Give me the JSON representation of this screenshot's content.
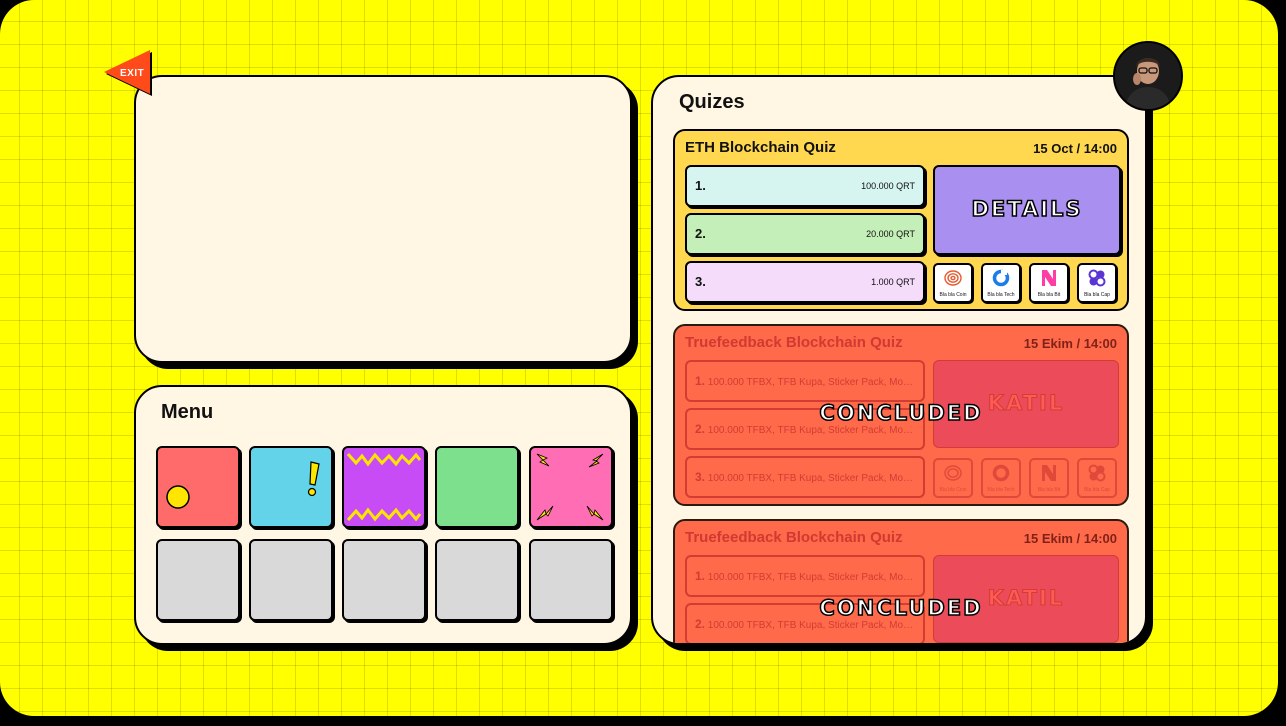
{
  "exit": {
    "label": "EXIT"
  },
  "menu": {
    "title": "Menu"
  },
  "quizzes": {
    "title": "Quizes",
    "items": [
      {
        "title": "ETH Blockchain Quiz",
        "date": "15 Oct / 14:00",
        "action": "DETAILS",
        "prizes": [
          {
            "rank": "1.",
            "amount": "100.000 QRT"
          },
          {
            "rank": "2.",
            "amount": "20.000 QRT"
          },
          {
            "rank": "3.",
            "amount": "1.000 QRT"
          }
        ],
        "sponsors": [
          "Bla bla Coin",
          "Bla bla Tech",
          "Bla bla Bit",
          "Bla bla Cap"
        ]
      },
      {
        "title": "Truefeedback Blockchain Quiz",
        "date": "15 Ekim / 14:00",
        "action": "KATIL",
        "status": "CONCLUDED",
        "prizes": [
          {
            "rank": "1.",
            "text": "100.000 TFBX, TFB Kupa, Sticker Pack, Mouse P..."
          },
          {
            "rank": "2.",
            "text": "100.000 TFBX, TFB Kupa, Sticker Pack, Mouse ..."
          },
          {
            "rank": "3.",
            "text": "100.000 TFBX, TFB Kupa, Sticker Pack, Mouse ..."
          }
        ],
        "sponsors": [
          "Bla bla Coin",
          "Bla bla Tech",
          "Bla bla Bit",
          "Bla bla Cap"
        ]
      },
      {
        "title": "Truefeedback Blockchain Quiz",
        "date": "15 Ekim / 14:00",
        "action": "KATIL",
        "status": "CONCLUDED",
        "prizes": [
          {
            "rank": "1.",
            "text": "100.000 TFBX, TFB Kupa, Sticker Pack, Mouse P..."
          },
          {
            "rank": "2.",
            "text": "100.000 TFBX, TFB Kupa, Sticker Pack, Mouse ..."
          }
        ]
      }
    ]
  },
  "colors": {
    "background": "#ffff00",
    "card": "#fff7e3",
    "exit": "#ff4a1a",
    "active_quiz": "#ffd84f",
    "concluded_quiz": "#ff6a4b",
    "details": "#a98ff0",
    "tile_red": "#ff6b6b",
    "tile_cyan": "#62d3e8",
    "tile_purple": "#c84cf5",
    "tile_green": "#7de08d",
    "tile_pink": "#ff6eb4",
    "tile_empty": "#d9d9d9"
  }
}
